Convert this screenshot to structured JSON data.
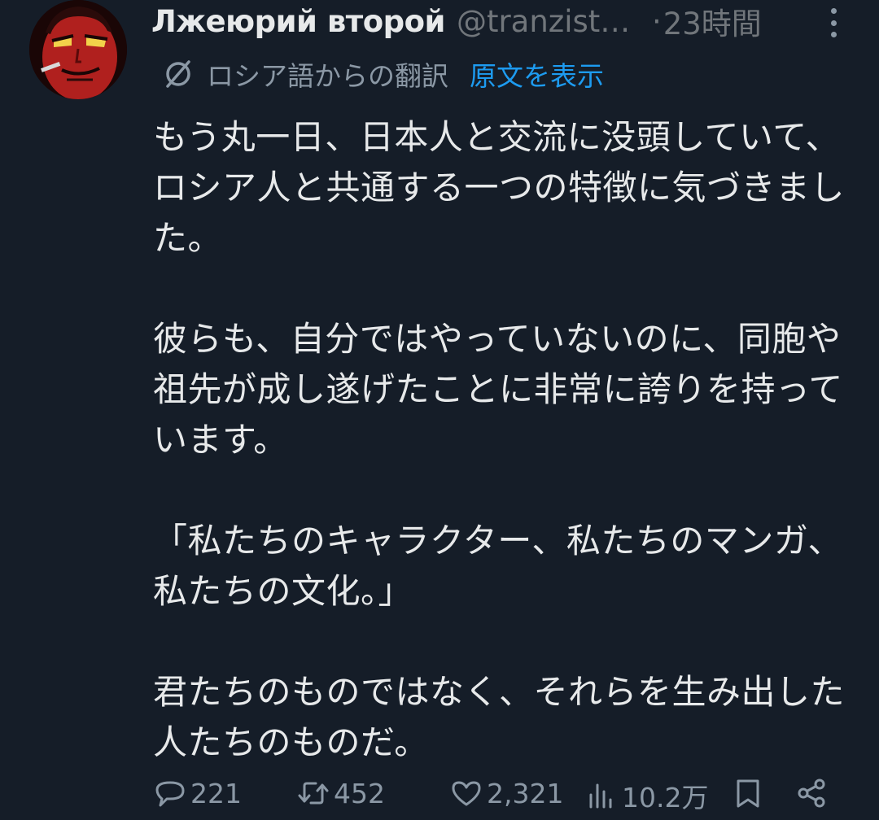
{
  "author": {
    "display_name": "Лжеюрий второй",
    "handle": "@tranzist…",
    "separator": "·",
    "time": "23時間"
  },
  "translation": {
    "label": "ロシア語からの翻訳",
    "show_original": "原文を表示"
  },
  "body": {
    "paragraphs": [
      "もう丸一日、日本人と交流に没頭していて、ロシア人と共通する一つの特徴に気づきました。",
      "彼らも、自分ではやっていないのに、同胞や祖先が成し遂げたことに非常に誇りを持っています。",
      "「私たちのキャラクター、私たちのマンガ、私たちの文化。」",
      "君たちのものではなく、それらを生み出した人たちのものだ。"
    ]
  },
  "stats": {
    "replies": "221",
    "reposts": "452",
    "likes": "2,321",
    "views": "10.2万"
  },
  "icons": {
    "reply": "reply-icon",
    "repost": "repost-icon",
    "like": "heart-icon",
    "views": "views-icon",
    "bookmark": "bookmark-icon",
    "share": "share-icon",
    "more": "more-icon",
    "translate": "translate-icon"
  },
  "colors": {
    "background": "#151d28",
    "text": "#e7e9ea",
    "muted": "#71767b",
    "link": "#1d9bf0"
  }
}
